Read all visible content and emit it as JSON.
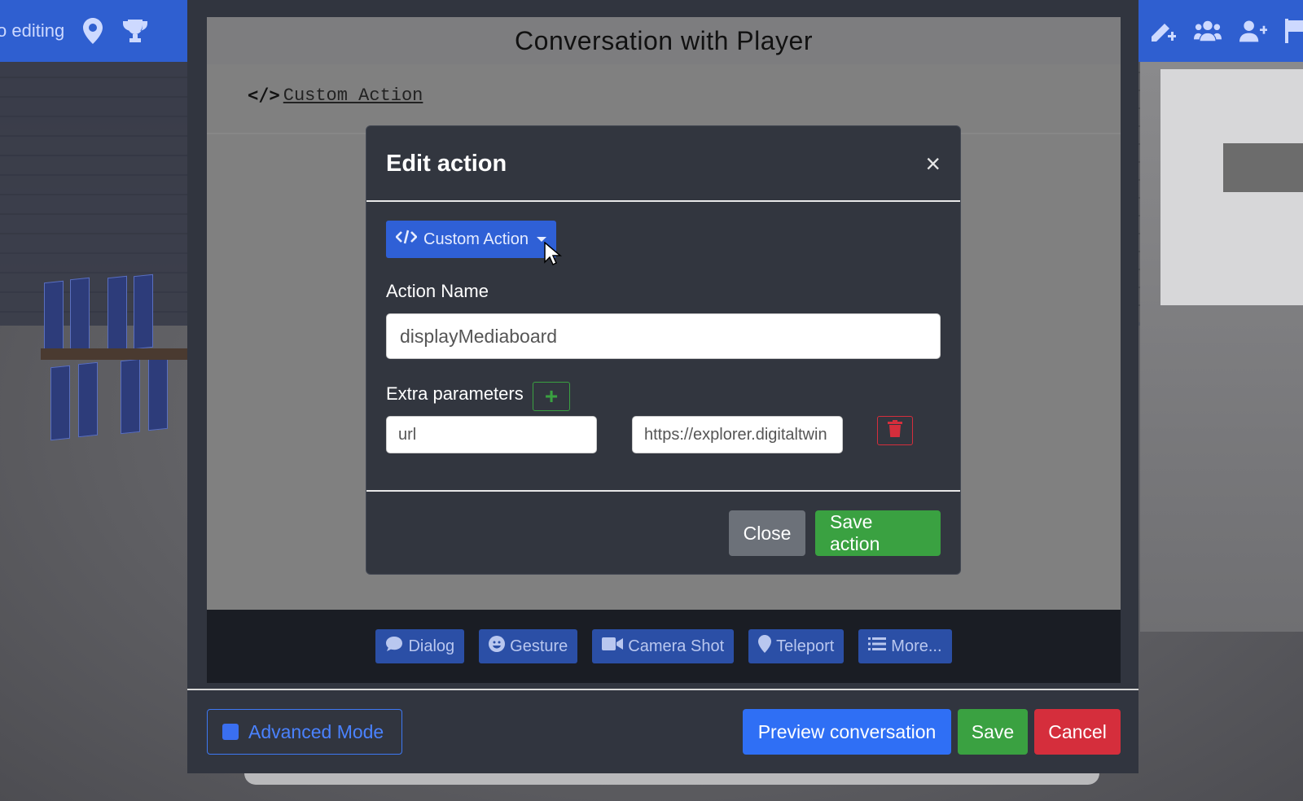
{
  "toolbar_left": {
    "label": "o editing",
    "icons": [
      "map-marker-icon",
      "trophy-icon"
    ]
  },
  "toolbar_right": {
    "icons": [
      "edit-plus-icon",
      "users-icon",
      "user-plus-icon",
      "flag-icon"
    ]
  },
  "window": {
    "title": "Conversation with Player",
    "action_item": {
      "icon": "code-icon",
      "label": " Custom Action"
    }
  },
  "tools": [
    {
      "label": "Dialog",
      "icon": "comment-icon"
    },
    {
      "label": "Gesture",
      "icon": "smile-icon"
    },
    {
      "label": "Camera Shot",
      "icon": "video-icon"
    },
    {
      "label": "Teleport",
      "icon": "map-marker-icon"
    },
    {
      "label": "More...",
      "icon": "list-icon"
    }
  ],
  "footer": {
    "advanced_mode": "Advanced Mode",
    "preview": "Preview conversation",
    "save": "Save",
    "cancel": "Cancel"
  },
  "modal": {
    "title": "Edit action",
    "close_glyph": "×",
    "type_dropdown": "Custom Action",
    "action_name_label": "Action Name",
    "action_name_value": "displayMediaboard",
    "extra_params_label": "Extra parameters",
    "params": [
      {
        "key": "url",
        "value": "https://explorer.digitaltwin"
      }
    ],
    "close_button": "Close",
    "save_button": "Save action"
  },
  "colors": {
    "primary": "#2f6ff5",
    "success": "#3aa141",
    "danger": "#d52e3c",
    "secondary": "#6c7179",
    "toolbar": "#2f5fd0"
  }
}
